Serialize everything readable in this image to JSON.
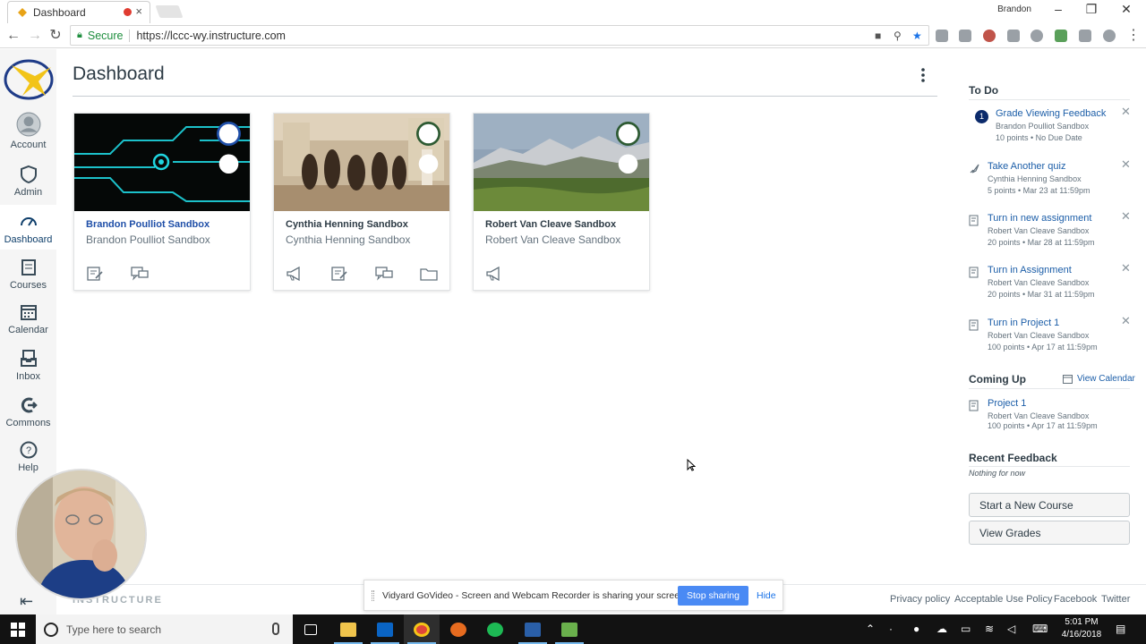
{
  "browser": {
    "tab_title": "Dashboard",
    "user_name": "Brandon",
    "secure_label": "Secure",
    "url": "https://lccc-wy.instructure.com"
  },
  "global_nav": {
    "items": [
      {
        "label": "Account",
        "icon": "user-icon"
      },
      {
        "label": "Admin",
        "icon": "shield-icon"
      },
      {
        "label": "Dashboard",
        "icon": "dashboard-gauge-icon"
      },
      {
        "label": "Courses",
        "icon": "book-icon"
      },
      {
        "label": "Calendar",
        "icon": "calendar-icon"
      },
      {
        "label": "Inbox",
        "icon": "inbox-icon"
      },
      {
        "label": "Commons",
        "icon": "commons-icon"
      },
      {
        "label": "Help",
        "icon": "help-icon"
      }
    ],
    "active": "Dashboard"
  },
  "main": {
    "title": "Dashboard",
    "cards": [
      {
        "title": "Brandon Poulliot Sandbox",
        "subtitle": "Brandon Poulliot Sandbox",
        "color": "#1f4fa8",
        "title_color": "#1f4fa8",
        "hero": "tech-circuit",
        "actions": [
          "assignments-icon",
          "discussions-icon"
        ]
      },
      {
        "title": "Cynthia Henning Sandbox",
        "subtitle": "Cynthia Henning Sandbox",
        "color": "#2d5a32",
        "title_color": "#2d3b45",
        "hero": "vintage-photo",
        "actions": [
          "announcements-icon",
          "assignments-icon",
          "discussions-icon",
          "files-icon"
        ]
      },
      {
        "title": "Robert Van Cleave Sandbox",
        "subtitle": "Robert Van Cleave Sandbox",
        "color": "#2d5a32",
        "title_color": "#2d3b45",
        "hero": "mountains",
        "actions": [
          "announcements-icon"
        ]
      }
    ]
  },
  "sidebar": {
    "todo_heading": "To Do",
    "todo": [
      {
        "title": "Grade Viewing Feedback",
        "course": "Brandon Poulliot Sandbox",
        "meta": "10 points • No Due Date",
        "badge": "1",
        "icon": "grade-badge"
      },
      {
        "title": "Take Another quiz",
        "course": "Cynthia Henning Sandbox",
        "meta": "5 points • Mar 23 at 11:59pm",
        "icon": "quiz-icon"
      },
      {
        "title": "Turn in new assignment",
        "course": "Robert Van Cleave Sandbox",
        "meta": "20 points • Mar 28 at 11:59pm",
        "icon": "assignment-icon"
      },
      {
        "title": "Turn in Assignment",
        "course": "Robert Van Cleave Sandbox",
        "meta": "20 points • Mar 31 at 11:59pm",
        "icon": "assignment-icon"
      },
      {
        "title": "Turn in Project 1",
        "course": "Robert Van Cleave Sandbox",
        "meta": "100 points • Apr 17 at 11:59pm",
        "icon": "assignment-icon"
      }
    ],
    "coming_up_heading": "Coming Up",
    "view_calendar": "View Calendar",
    "coming_up": [
      {
        "title": "Project 1",
        "course": "Robert Van Cleave Sandbox",
        "meta": "100 points • Apr 17 at 11:59pm"
      }
    ],
    "recent_feedback_heading": "Recent Feedback",
    "nothing_for_now": "Nothing for now",
    "start_course_button": "Start a New Course",
    "view_grades_button": "View Grades"
  },
  "footer": {
    "brand": "INSTRUCTURE",
    "links": [
      "Privacy policy",
      "Acceptable Use Policy",
      "Facebook",
      "Twitter"
    ]
  },
  "share_bar": {
    "message": "Vidyard GoVideo - Screen and Webcam Recorder is sharing your screen.",
    "stop_label": "Stop sharing",
    "hide_label": "Hide"
  },
  "taskbar": {
    "search_placeholder": "Type here to search",
    "time": "5:01 PM",
    "date": "4/16/2018"
  }
}
